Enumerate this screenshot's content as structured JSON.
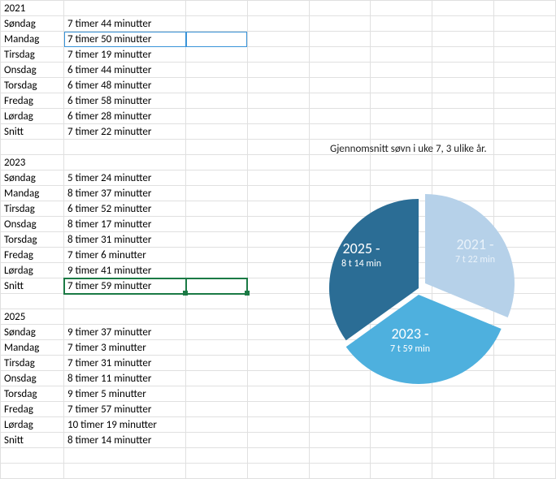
{
  "blocks": [
    {
      "year": "2021",
      "rows": [
        {
          "day": "Søndag",
          "dur": "7 timer 44 minutter"
        },
        {
          "day": "Mandag",
          "dur": "7 timer 50 minutter"
        },
        {
          "day": "Tirsdag",
          "dur": "7 timer 19 minutter"
        },
        {
          "day": "Onsdag",
          "dur": "6 timer 44 minutter"
        },
        {
          "day": "Torsdag",
          "dur": "6 timer 48 minutter"
        },
        {
          "day": "Fredag",
          "dur": "6 timer 58 minutter"
        },
        {
          "day": "Lørdag",
          "dur": "6 timer 28 minutter"
        },
        {
          "day": "Snitt",
          "dur": "7 timer 22 minutter"
        }
      ]
    },
    {
      "year": "2023",
      "rows": [
        {
          "day": "Søndag",
          "dur": "5 timer 24 minutter"
        },
        {
          "day": "Mandag",
          "dur": "8 timer 37 minutter"
        },
        {
          "day": "Tirsdag",
          "dur": "6 timer 52 minutter"
        },
        {
          "day": "Onsdag",
          "dur": "8 timer 17 minutter"
        },
        {
          "day": "Torsdag",
          "dur": "8 timer 31 minutter"
        },
        {
          "day": "Fredag",
          "dur": "7 timer 6 minutter"
        },
        {
          "day": "Lørdag",
          "dur": "9 timer 41 minutter"
        },
        {
          "day": "Snitt",
          "dur": "7 timer 59 minutter"
        }
      ]
    },
    {
      "year": "2025",
      "rows": [
        {
          "day": "Søndag",
          "dur": "9 timer 37 minutter"
        },
        {
          "day": "Mandag",
          "dur": "7 timer 3 minutter"
        },
        {
          "day": "Tirsdag",
          "dur": "7 timer 31 minutter"
        },
        {
          "day": "Onsdag",
          "dur": "8 timer 11 minutter"
        },
        {
          "day": "Torsdag",
          "dur": "9 timer 5 minutter"
        },
        {
          "day": "Fredag",
          "dur": "7 timer 57 minutter"
        },
        {
          "day": "Lørdag",
          "dur": "10 timer 19 minutter"
        },
        {
          "day": "Snitt",
          "dur": "8 timer 14 minutter"
        }
      ]
    }
  ],
  "chart_title": "Gjennomsnitt søvn i uke 7, 3 ulike år.",
  "chart_data": {
    "type": "pie",
    "title": "Gjennomsnitt søvn i uke 7, 3 ulike år.",
    "series": [
      {
        "name": "2021",
        "value_min": 442,
        "label_year": "2021 -",
        "label_sub": "7 t 22 min",
        "color": "#b6d1e9"
      },
      {
        "name": "2023",
        "value_min": 479,
        "label_year": "2023 -",
        "label_sub": "7 t 59 min",
        "color": "#4eb0de"
      },
      {
        "name": "2025",
        "value_min": 494,
        "label_year": "2025 -",
        "label_sub": "8 t 14 min",
        "color": "#2b6d95"
      }
    ],
    "legend": false,
    "exploded": true
  }
}
